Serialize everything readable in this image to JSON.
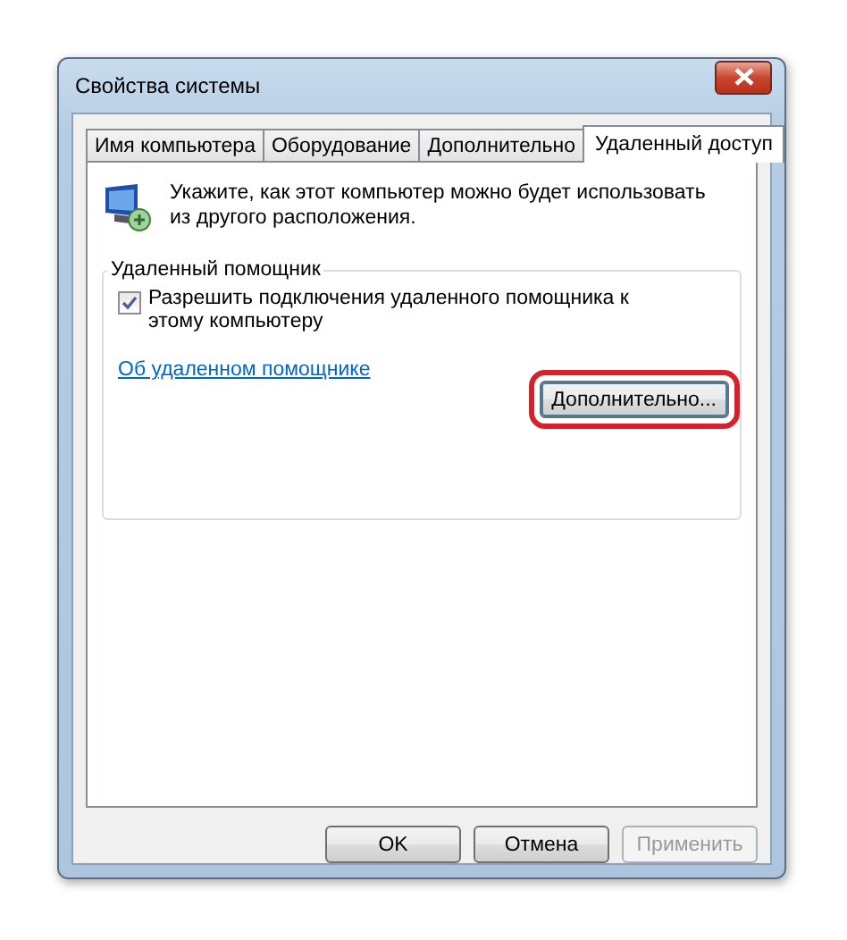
{
  "window": {
    "title": "Свойства системы"
  },
  "tabs": [
    {
      "label": "Имя компьютера",
      "selected": false
    },
    {
      "label": "Оборудование",
      "selected": false
    },
    {
      "label": "Дополнительно",
      "selected": false
    },
    {
      "label": "Удаленный доступ",
      "selected": true
    }
  ],
  "intro": "Укажите, как этот компьютер можно будет использовать из другого расположения.",
  "group": {
    "title": "Удаленный помощник",
    "checkbox": {
      "label": "Разрешить подключения удаленного помощника к этому компьютеру",
      "checked": true
    },
    "link": "Об удаленном помощнике",
    "advanced_button": {
      "label": "Дополнительно...",
      "highlighted": true
    }
  },
  "buttons": [
    {
      "label": "OK",
      "disabled": false
    },
    {
      "label": "Отмена",
      "disabled": false
    },
    {
      "label": "Применить",
      "disabled": true
    }
  ]
}
